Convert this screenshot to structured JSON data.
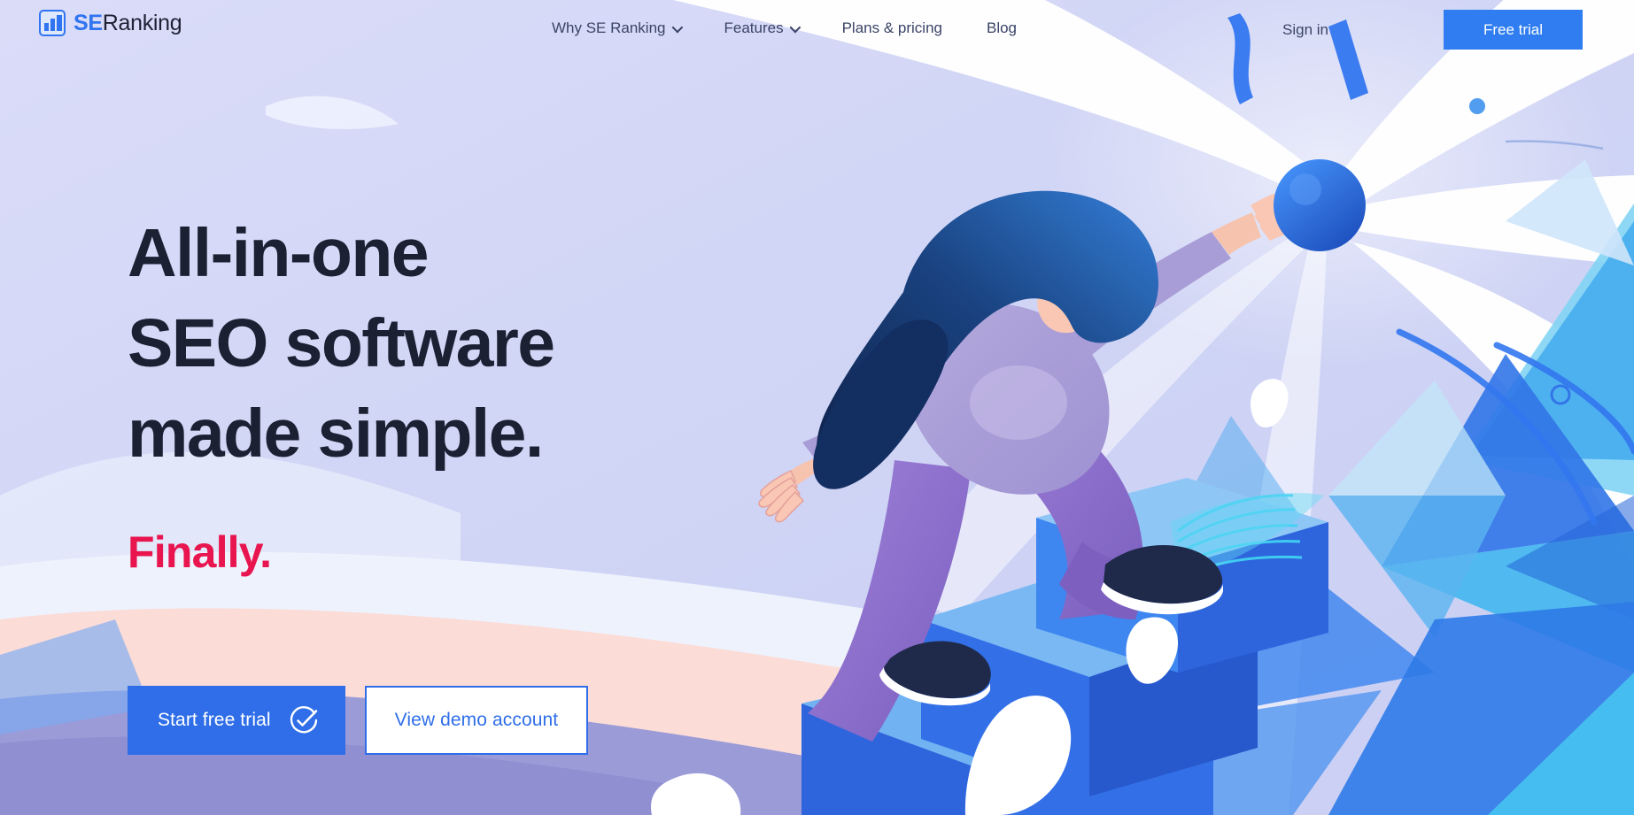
{
  "brand": {
    "logo_icon": "bar-chart-icon",
    "name_part1": "SE",
    "name_part2": "Ranking",
    "accent_blue": "#2f74f0",
    "accent_red": "#e8154f",
    "headline_color": "#1b2033"
  },
  "nav": {
    "items": [
      {
        "label": "Why SE Ranking",
        "has_dropdown": true,
        "icon": "chevron-down-icon"
      },
      {
        "label": "Features",
        "has_dropdown": true,
        "icon": "chevron-down-icon"
      },
      {
        "label": "Plans & pricing",
        "has_dropdown": false
      },
      {
        "label": "Blog",
        "has_dropdown": false
      }
    ],
    "sign_in": "Sign in",
    "free_trial": "Free trial"
  },
  "hero": {
    "headline_line1": "All-in-one",
    "headline_line2": "SEO software",
    "headline_line3": "made simple.",
    "subheadline": "Finally.",
    "primary_cta": "Start free trial",
    "primary_cta_icon": "check-circle-icon",
    "secondary_cta": "View demo account"
  },
  "illustration": {
    "name": "woman-climbing-blue-steps",
    "palette": {
      "background_lavender": "#d5d8f6",
      "pale_blue": "#dfe6fb",
      "white": "#ffffff",
      "pink": "#fbd7d3",
      "periwinkle": "#9a9ad8",
      "step_blue": "#2f6ee8",
      "step_blue_light": "#68a9f0",
      "cyan": "#46c8f0",
      "deep_navy": "#16306b",
      "hair_blue": "#14356f",
      "skin": "#fbc2ad",
      "pants_purple": "#8b6ccb",
      "shirt_lilac": "#a59ad4",
      "shoe_navy": "#1b2648",
      "sphere_blue": "#1f63d8"
    }
  }
}
